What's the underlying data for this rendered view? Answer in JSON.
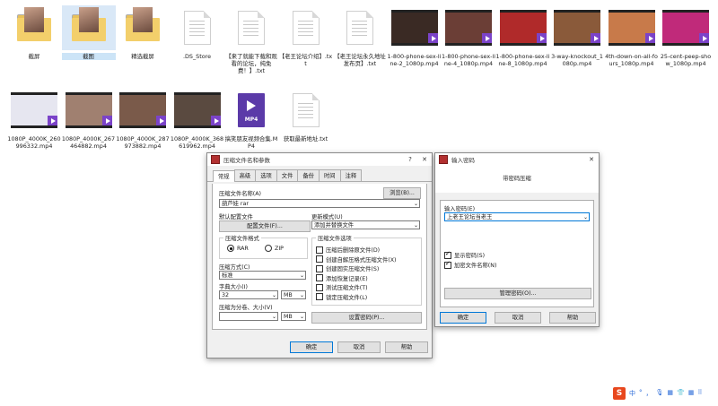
{
  "desktop": {
    "row1": [
      {
        "name": "截屏",
        "kind": "folder"
      },
      {
        "name": "截图",
        "kind": "folder",
        "selected": true
      },
      {
        "name": "精选截屏",
        "kind": "folder"
      },
      {
        "name": ".DS_Store",
        "kind": "doc"
      },
      {
        "name": "【来了就能下载和观看的论坛，纯免费！】.txt",
        "kind": "doc"
      },
      {
        "name": "【老王论坛介绍】.txt",
        "kind": "doc"
      },
      {
        "name": "【老王论坛永久地址发布页】.txt",
        "kind": "doc"
      },
      {
        "name": "1-800-phone-sex-line-2_1080p.mp4",
        "kind": "video",
        "color": "#3a2a24"
      },
      {
        "name": "1-800-phone-sex-line-4_1080p.mp4",
        "kind": "video",
        "color": "#6b3e36"
      },
      {
        "name": "1-800-phone-sex-line-8_1080p.mp4",
        "kind": "video",
        "color": "#b02a2a"
      },
      {
        "name": "3-way-knockout_1080p.mp4",
        "kind": "video",
        "color": "#8a5a3a"
      },
      {
        "name": "4th-down-on-all-fours_1080p.mp4",
        "kind": "video",
        "color": "#c87a4a"
      },
      {
        "name": "25-cent-peep-show_1080p.mp4",
        "kind": "video",
        "color": "#c02a7a"
      }
    ],
    "row2": [
      {
        "name": "1080P_4000K_260996332.mp4",
        "kind": "video",
        "color": "#e6e6f0"
      },
      {
        "name": "1080P_4000K_267464882.mp4",
        "kind": "video",
        "color": "#a08070"
      },
      {
        "name": "1080P_4000K_287973882.mp4",
        "kind": "video",
        "color": "#7a5a4a"
      },
      {
        "name": "1080P_4000K_368619962.mp4",
        "kind": "video",
        "color": "#5a4a40"
      },
      {
        "name": "搞笑朋友视频合集.MP4",
        "kind": "mp4"
      },
      {
        "name": "获取最新地址.txt",
        "kind": "doc"
      }
    ],
    "mp4_badge": "MP4"
  },
  "archive_dialog": {
    "title": "压缩文件名和参数",
    "help_glyph": "?",
    "close_glyph": "✕",
    "tabs": [
      "常规",
      "高级",
      "选项",
      "文件",
      "备份",
      "时间",
      "注释"
    ],
    "archive_name_label": "压缩文件名称(A)",
    "browse_button": "浏览(B)...",
    "archive_name_value": "葫芦娃 rar",
    "default_profile_label": "默认配置文件",
    "profile_button": "配置文件(F)...",
    "update_mode_label": "更新模式(U)",
    "update_mode_value": "添加并替换文件",
    "format_group": "压缩文件格式",
    "format_rar": "RAR",
    "format_zip": "ZIP",
    "method_label": "压缩方式(C)",
    "method_value": "标准",
    "dict_label": "字典大小(I)",
    "dict_value": "32",
    "dict_unit": "MB",
    "split_label": "压缩为分卷、大小(V)",
    "split_unit": "MB",
    "options_group": "压缩文件选项",
    "options": [
      {
        "label": "压缩后删除原文件(D)",
        "checked": false
      },
      {
        "label": "创建自解压格式压缩文件(X)",
        "checked": false
      },
      {
        "label": "创建固实压缩文件(S)",
        "checked": false
      },
      {
        "label": "添加恢复记录(E)",
        "checked": false
      },
      {
        "label": "测试压缩文件(T)",
        "checked": false
      },
      {
        "label": "锁定压缩文件(L)",
        "checked": false
      }
    ],
    "set_password_button": "设置密码(P)...",
    "ok_button": "确定",
    "cancel_button": "取消",
    "help_button": "帮助"
  },
  "password_dialog": {
    "title": "输入密码",
    "close_glyph": "✕",
    "subtitle": "带密码压缩",
    "enter_label": "输入密码(E)",
    "password_value": "上老王论坛当老王",
    "show_password": "显示密码(S)",
    "encrypt_names": "加密文件名称(N)",
    "manage_button": "管理密码(O)...",
    "ok_button": "确定",
    "cancel_button": "取消",
    "help_button": "帮助"
  },
  "tray": {
    "ime_logo": "S",
    "items": [
      "中",
      "°",
      "，",
      "🎙",
      "▦",
      "👕",
      "▦",
      "⠿"
    ]
  }
}
